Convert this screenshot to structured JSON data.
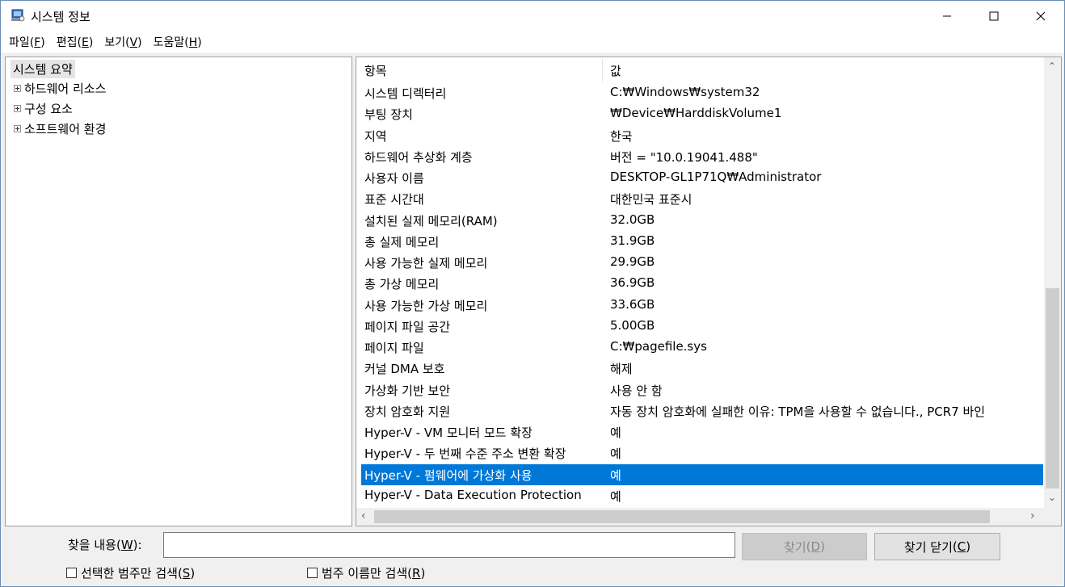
{
  "window": {
    "title": "시스템 정보"
  },
  "menu": [
    {
      "label": "파일",
      "accel": "F"
    },
    {
      "label": "편집",
      "accel": "E"
    },
    {
      "label": "보기",
      "accel": "V"
    },
    {
      "label": "도움말",
      "accel": "H"
    }
  ],
  "tree": {
    "root": "시스템 요약",
    "items": [
      "하드웨어 리소스",
      "구성 요소",
      "소프트웨어 환경"
    ]
  },
  "list": {
    "headers": {
      "item": "항목",
      "value": "값"
    },
    "rows": [
      {
        "item": "시스템 디렉터리",
        "value": "C:₩Windows₩system32"
      },
      {
        "item": "부팅 장치",
        "value": "₩Device₩HarddiskVolume1"
      },
      {
        "item": "지역",
        "value": "한국"
      },
      {
        "item": "하드웨어 추상화 계층",
        "value": "버전 = \"10.0.19041.488\""
      },
      {
        "item": "사용자 이름",
        "value": "DESKTOP-GL1P71Q₩Administrator"
      },
      {
        "item": "표준 시간대",
        "value": "대한민국 표준시"
      },
      {
        "item": "설치된 실제 메모리(RAM)",
        "value": "32.0GB"
      },
      {
        "item": "총 실제 메모리",
        "value": "31.9GB"
      },
      {
        "item": "사용 가능한 실제 메모리",
        "value": "29.9GB"
      },
      {
        "item": "총 가상 메모리",
        "value": "36.9GB"
      },
      {
        "item": "사용 가능한 가상 메모리",
        "value": "33.6GB"
      },
      {
        "item": "페이지 파일 공간",
        "value": "5.00GB"
      },
      {
        "item": "페이지 파일",
        "value": "C:₩pagefile.sys"
      },
      {
        "item": "커널 DMA 보호",
        "value": "해제"
      },
      {
        "item": "가상화 기반 보안",
        "value": "사용 안 함"
      },
      {
        "item": "장치 암호화 지원",
        "value": "자동 장치 암호화에 실패한 이유: TPM을 사용할 수 없습니다., PCR7 바인"
      },
      {
        "item": "Hyper-V - VM 모니터 모드 확장",
        "value": "예"
      },
      {
        "item": "Hyper-V - 두 번째 수준 주소 변환 확장",
        "value": "예"
      },
      {
        "item": "Hyper-V - 펌웨어에 가상화 사용",
        "value": "예",
        "selected": true
      },
      {
        "item": "Hyper-V - Data Execution Protection",
        "value": "예"
      }
    ]
  },
  "find": {
    "label": "찾을 내용",
    "label_accel": "W",
    "input_value": "",
    "find_button": "찾기",
    "find_accel": "D",
    "close_button": "찾기 닫기",
    "close_accel": "C",
    "check_selected_category": "선택한 범주만 검색",
    "check_selected_accel": "S",
    "check_category_names": "범주 이름만 검색",
    "check_names_accel": "R"
  },
  "colors": {
    "selection": "#0078d7",
    "window_border": "#6b8fb5"
  }
}
